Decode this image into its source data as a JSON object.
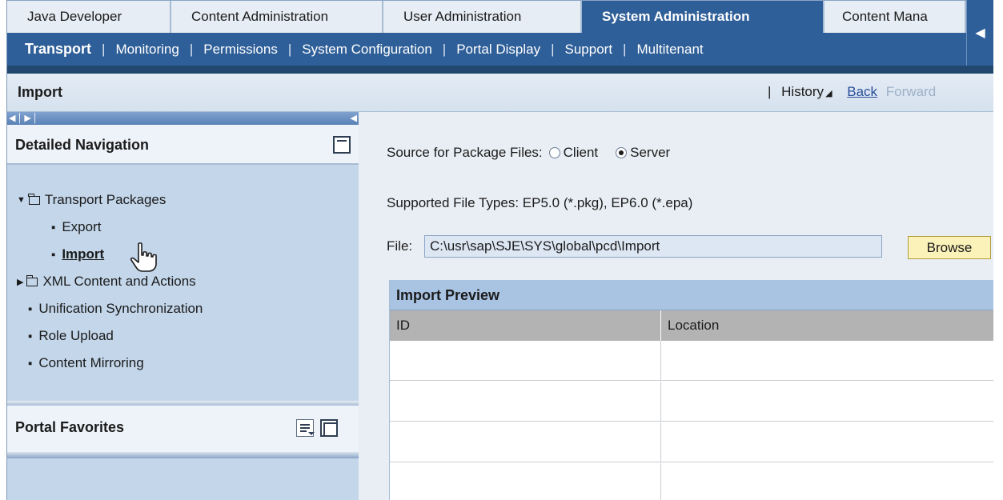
{
  "top_tabs": [
    {
      "label": "Java Developer",
      "active": false
    },
    {
      "label": "Content Administration",
      "active": false
    },
    {
      "label": "User Administration",
      "active": false
    },
    {
      "label": "System Administration",
      "active": true
    },
    {
      "label": "Content Mana",
      "active": false
    }
  ],
  "tab_scroll_icon": "caret-left-icon",
  "sub_nav": [
    {
      "label": "Transport",
      "active": true
    },
    {
      "label": "Monitoring",
      "active": false
    },
    {
      "label": "Permissions",
      "active": false
    },
    {
      "label": "System Configuration",
      "active": false
    },
    {
      "label": "Portal Display",
      "active": false
    },
    {
      "label": "Support",
      "active": false
    },
    {
      "label": "Multitenant",
      "active": false
    }
  ],
  "sub_nav_separator": "|",
  "title_bar": {
    "page_title": "Import",
    "separator": "|",
    "history_label": "History",
    "back_label": "Back",
    "forward_label": "Forward"
  },
  "detailed_navigation": {
    "title": "Detailed Navigation",
    "tree": {
      "transport_packages": "Transport Packages",
      "export": "Export",
      "import": "Import",
      "xml_content": "XML Content and Actions",
      "unification": "Unification Synchronization",
      "role_upload": "Role Upload",
      "content_mirroring": "Content Mirroring"
    }
  },
  "portal_favorites": {
    "title": "Portal Favorites"
  },
  "main": {
    "source_label": "Source for Package Files:",
    "source_options": [
      {
        "label": "Client",
        "selected": false
      },
      {
        "label": "Server",
        "selected": true
      }
    ],
    "supported_types": "Supported File Types: EP5.0 (*.pkg), EP6.0 (*.epa)",
    "file_label": "File:",
    "file_value": "C:\\usr\\sap\\SJE\\SYS\\global\\pcd\\Import",
    "browse_label": "Browse"
  },
  "import_preview": {
    "title": "Import Preview",
    "columns": [
      "ID",
      "Location"
    ],
    "rows": [
      [
        "",
        ""
      ],
      [
        "",
        ""
      ],
      [
        "",
        ""
      ],
      [
        "",
        ""
      ]
    ]
  },
  "colors": {
    "nav_blue": "#2f5f98",
    "panel_blue": "#c3d6ea",
    "header_blue": "#a9c3e3",
    "browse_yellow": "#fbf2b9",
    "link_blue": "#2a4e9c"
  }
}
